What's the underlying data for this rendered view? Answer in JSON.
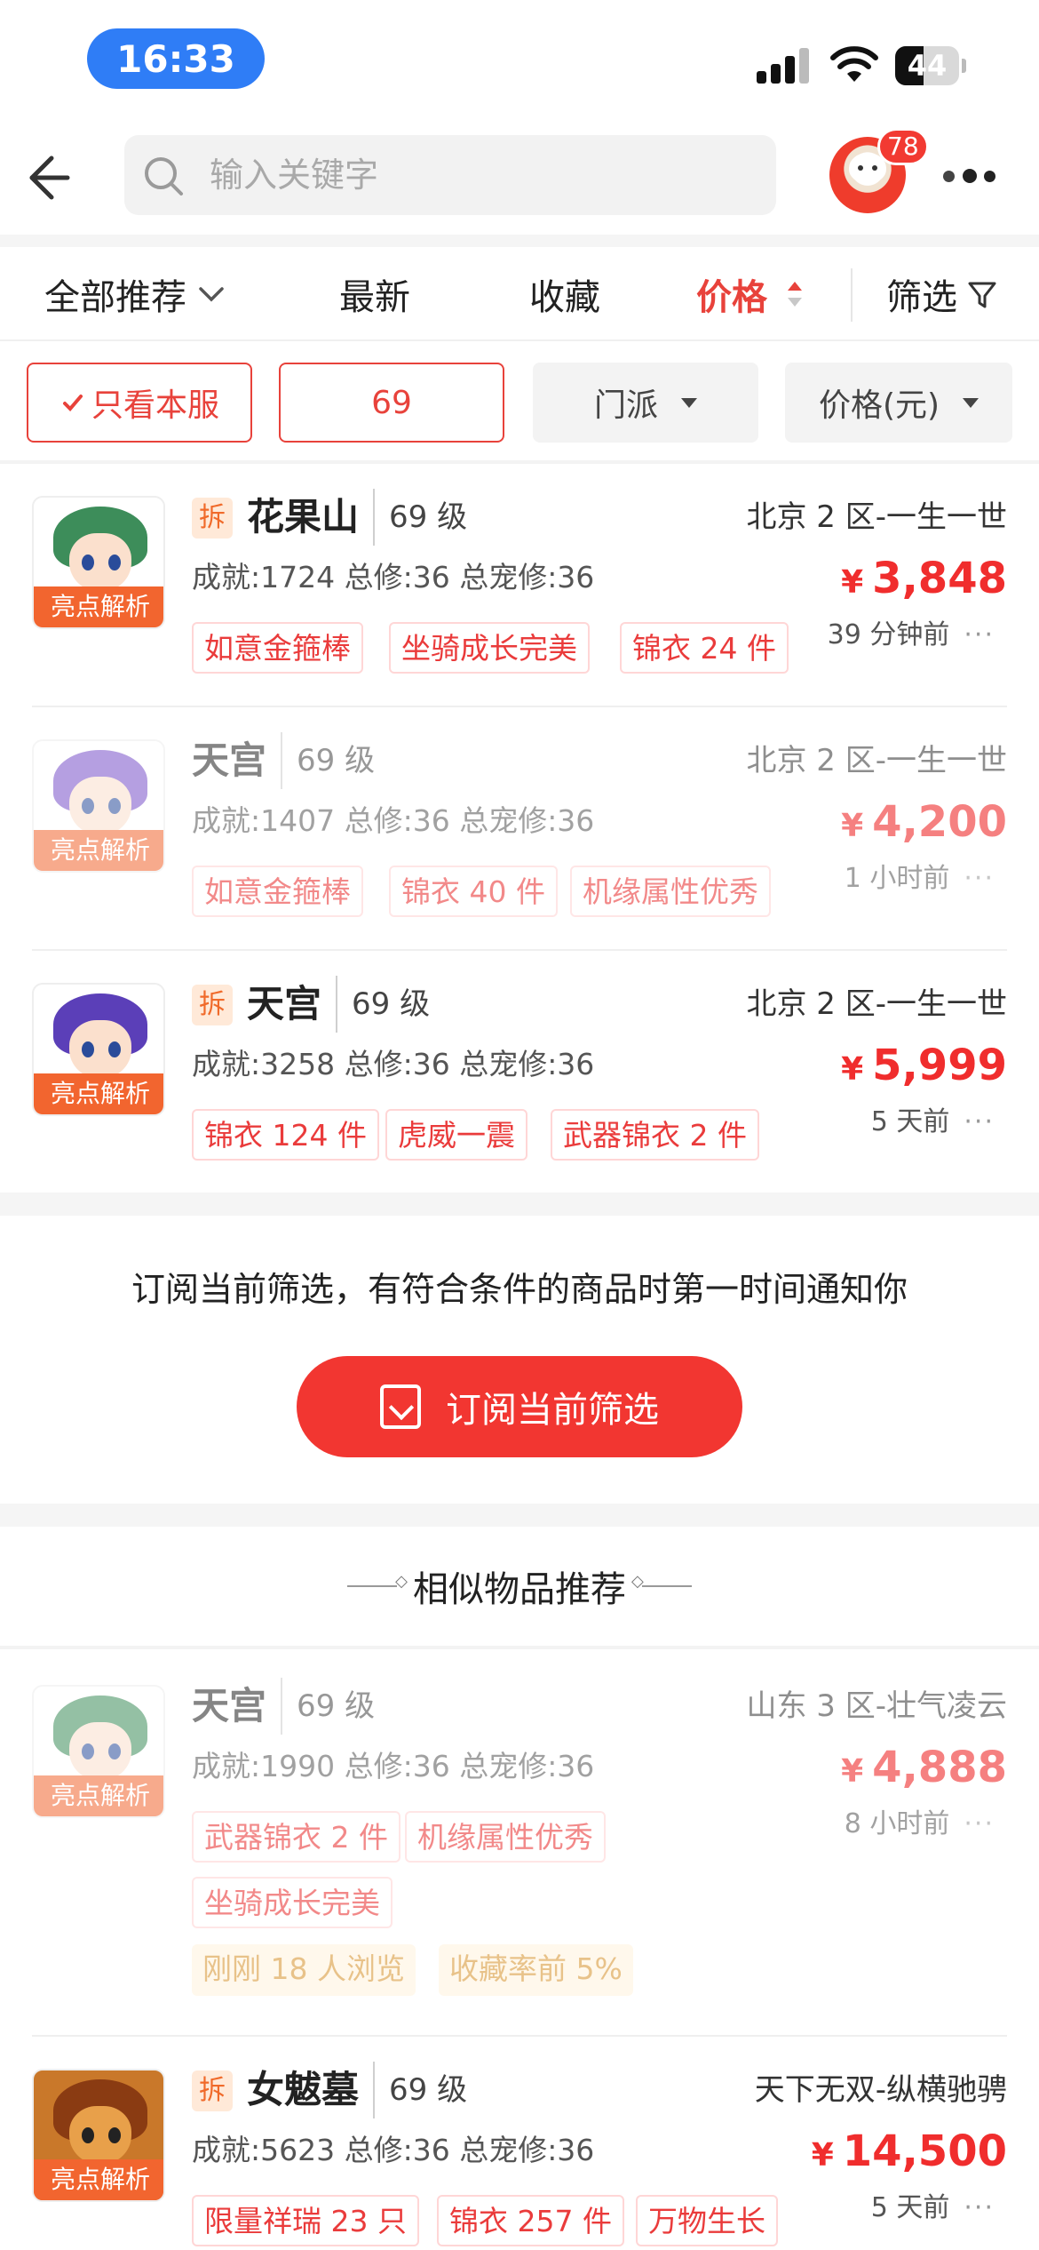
{
  "status_bar": {
    "time": "16:33",
    "battery": "44",
    "battery_level": 0.44
  },
  "header": {
    "search_placeholder": "输入关键字",
    "notification_count": "78"
  },
  "sort_tabs": [
    {
      "label": "全部推荐",
      "active": false
    },
    {
      "label": "最新",
      "active": false
    },
    {
      "label": "收藏",
      "active": false
    },
    {
      "label": "价格",
      "active": true
    },
    {
      "label": "筛选",
      "active": false
    }
  ],
  "filters": {
    "only_this_server": "只看本服",
    "level_value": "69",
    "school": "门派",
    "price": "价格(元)"
  },
  "listings": [
    {
      "chai": "拆",
      "name": "花果山",
      "level": "69 级",
      "server": "北京 2 区-一生一世",
      "stats": "成就:1724 总修:36 总宠修:36",
      "price": "3,848",
      "time": "39 分钟前",
      "tags": [
        "如意金箍棒",
        "坐骑成长完美",
        "锦衣 24 件"
      ],
      "thumb_label": "亮点解析"
    },
    {
      "chai": "",
      "name": "天宫",
      "level": "69 级",
      "server": "北京 2 区-一生一世",
      "stats": "成就:1407 总修:36 总宠修:36",
      "price": "4,200",
      "time": "1 小时前",
      "tags": [
        "如意金箍棒",
        "锦衣 40 件",
        "机缘属性优秀"
      ],
      "thumb_label": "亮点解析"
    },
    {
      "chai": "拆",
      "name": "天宫",
      "level": "69 级",
      "server": "北京 2 区-一生一世",
      "stats": "成就:3258 总修:36 总宠修:36",
      "price": "5,999",
      "time": "5 天前",
      "tags": [
        "锦衣 124 件",
        "虎威一震",
        "武器锦衣 2 件"
      ],
      "thumb_label": "亮点解析"
    }
  ],
  "subscribe": {
    "text": "订阅当前筛选，有符合条件的商品时第一时间通知你",
    "button": "订阅当前筛选"
  },
  "similar": {
    "title": "相似物品推荐",
    "items": [
      {
        "chai": "",
        "name": "天宫",
        "level": "69 级",
        "server": "山东 3 区-壮气凌云",
        "stats": "成就:1990 总修:36 总宠修:36",
        "price": "4,888",
        "time": "8 小时前",
        "tags": [
          "武器锦衣 2 件",
          "机缘属性优秀",
          "坐骑成长完美"
        ],
        "gold_tags": [
          "刚刚 18 人浏览",
          "收藏率前 5%"
        ],
        "thumb_label": "亮点解析"
      },
      {
        "chai": "拆",
        "name": "女魃墓",
        "level": "69 级",
        "server": "天下无双-纵横驰骋",
        "stats": "成就:5623 总修:36 总宠修:36",
        "price": "14,500",
        "time": "5 天前",
        "tags": [
          "限量祥瑞 23 只",
          "锦衣 257 件",
          "万物生长"
        ],
        "thumb_label": "亮点解析"
      }
    ]
  },
  "currency": "¥",
  "colors": {
    "accent": "#e8423b",
    "price": "#f02d2d",
    "time_pill": "#2f7df6",
    "thumb_label": "#f2652f"
  }
}
